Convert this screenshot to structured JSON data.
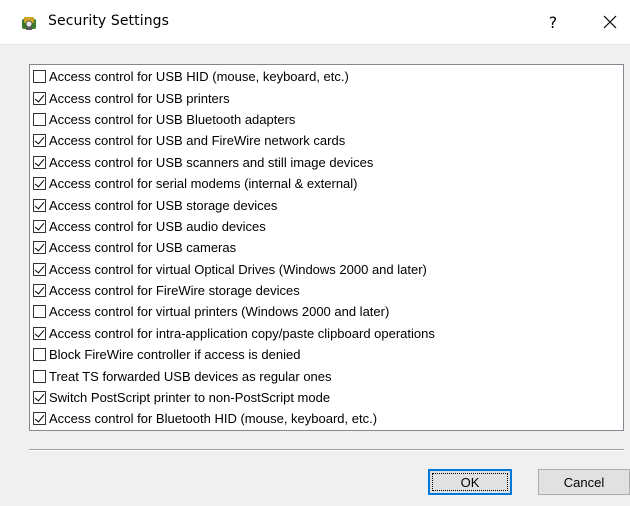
{
  "window": {
    "title": "Security Settings",
    "help_label": "?",
    "close_label": "✕",
    "icon": "security-shield-icon"
  },
  "options": [
    {
      "label": "Access control for USB HID (mouse, keyboard, etc.)",
      "checked": false
    },
    {
      "label": "Access control for USB printers",
      "checked": true
    },
    {
      "label": "Access control for USB Bluetooth adapters",
      "checked": false
    },
    {
      "label": "Access control for USB and FireWire network cards",
      "checked": true
    },
    {
      "label": "Access control for USB scanners and still image devices",
      "checked": true
    },
    {
      "label": "Access control for serial modems (internal & external)",
      "checked": true
    },
    {
      "label": "Access control for USB storage devices",
      "checked": true
    },
    {
      "label": "Access control for USB audio devices",
      "checked": true
    },
    {
      "label": "Access control for USB cameras",
      "checked": true
    },
    {
      "label": "Access control for virtual Optical Drives (Windows 2000 and later)",
      "checked": true
    },
    {
      "label": "Access control for FireWire storage devices",
      "checked": true
    },
    {
      "label": "Access control for virtual printers (Windows 2000 and later)",
      "checked": false
    },
    {
      "label": "Access control for intra-application copy/paste clipboard operations",
      "checked": true
    },
    {
      "label": "Block FireWire controller if access is denied",
      "checked": false
    },
    {
      "label": "Treat TS forwarded USB devices as regular ones",
      "checked": false
    },
    {
      "label": "Switch PostScript printer to non-PostScript mode",
      "checked": true
    },
    {
      "label": "Access control for Bluetooth HID (mouse, keyboard, etc.)",
      "checked": true
    }
  ],
  "buttons": {
    "ok_label": "OK",
    "cancel_label": "Cancel"
  },
  "colors": {
    "focus_border": "#0078d7",
    "background": "#f0f0f0"
  }
}
